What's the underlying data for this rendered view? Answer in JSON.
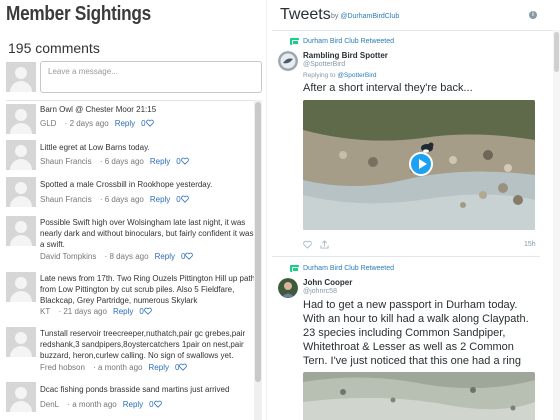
{
  "comments_panel": {
    "title": "Member Sightings",
    "count_label": "195 comments",
    "input_placeholder": "Leave a message...",
    "reply_label": "Reply",
    "comments": [
      {
        "text": "Barn Owl @ Chester Moor 21:15",
        "author": "GLD",
        "time": "2 days ago",
        "likes": "0"
      },
      {
        "text": "Little egret at Low Barns today.",
        "author": "Shaun Francis",
        "time": "6 days ago",
        "likes": "0"
      },
      {
        "text": "Spotted a male Crossbill in Rookhope yesterday.",
        "author": "Shaun Francis",
        "time": "6 days ago",
        "likes": "0"
      },
      {
        "text": "Possible Swift high over Wolsingham late last night, it was nearly dark and without binoculars, but fairly confident it was a swift.",
        "author": "David Tompkins",
        "time": "8 days ago",
        "likes": "0"
      },
      {
        "text": "Late news from 17th. Two Ring Ouzels Pittington Hill up path from Low Pittington by cut scrub piles. Also 5 Fieldfare, Blackcap, Grey Partridge, numerous Skylark",
        "author": "KT",
        "time": "21 days ago",
        "likes": "0"
      },
      {
        "text": "Tunstall reservoir treecreeper,nuthatch,pair gc grebes,pair redshank,3 sandpipers,8oystercatchers 1pair on nest,pair buzzard, heron,curlew calling. No sign of swallows yet.",
        "author": "Fred hobson",
        "time": "a month ago",
        "likes": "0"
      },
      {
        "text": "Dcac fishing ponds brasside sand martins just arrived",
        "author": "DenL",
        "time": "a month ago",
        "likes": "0"
      }
    ]
  },
  "tweets_panel": {
    "title": "Tweets",
    "by_prefix": "by",
    "by_handle": "@DurhamBirdClub",
    "tweets": [
      {
        "retweet_label": "Durham Bird Club Retweeted",
        "name": "Rambling Bird Spotter",
        "handle": "@SpotterBird",
        "replying_prefix": "Replying to",
        "replying_handle": "@SpotterBird",
        "text": "After a short interval they're back...",
        "time": "15h",
        "has_video": true
      },
      {
        "retweet_label": "Durham Bird Club Retweeted",
        "name": "John Cooper",
        "handle": "@johnrc58",
        "text": "Had to get a new passport in Durham today. With an hour to kill had a walk along Claypath. 23 species including Common Sandpiper, Whitethroat & Lesser as well as 2 Common Tern. I've just noticed that this one had a ring on"
      }
    ]
  },
  "colors": {
    "link": "#2a6ebb",
    "twitter_blue": "#1da1f2",
    "retweet_green": "#19cf86"
  }
}
